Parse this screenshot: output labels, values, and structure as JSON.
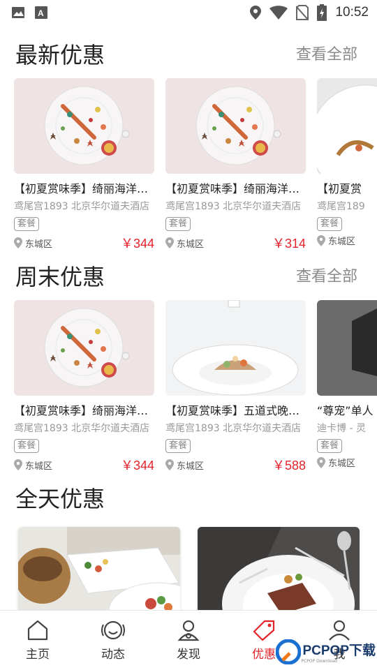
{
  "status_bar": {
    "time": "10:52"
  },
  "sections": [
    {
      "title": "最新优惠",
      "view_all": "查看全部",
      "cards": [
        {
          "title": "【初夏赏味季】绮丽海洋…",
          "venue": "鸢尾宫1893 北京华尔道夫酒店",
          "tag": "套餐",
          "district": "东城区",
          "price": "￥344"
        },
        {
          "title": "【初夏赏味季】绮丽海洋…",
          "venue": "鸢尾宫1893 北京华尔道夫酒店",
          "tag": "套餐",
          "district": "东城区",
          "price": "￥314"
        },
        {
          "title": "【初夏赏",
          "venue": "鸢尾宫189",
          "tag": "套餐",
          "district": "东城区",
          "price": ""
        }
      ]
    },
    {
      "title": "周末优惠",
      "view_all": "查看全部",
      "cards": [
        {
          "title": "【初夏赏味季】绮丽海洋…",
          "venue": "鸢尾宫1893 北京华尔道夫酒店",
          "tag": "套餐",
          "district": "东城区",
          "price": "￥344"
        },
        {
          "title": "【初夏赏味季】五道式晚…",
          "venue": "鸢尾宫1893 北京华尔道夫酒店",
          "tag": "套餐",
          "district": "东城区",
          "price": "￥588"
        },
        {
          "title": "“尊宠”单人",
          "venue": "迪卡博 - 灵",
          "tag": "套餐",
          "district": "东城区",
          "price": ""
        }
      ]
    }
  ],
  "allday": {
    "title": "全天优惠"
  },
  "nav": [
    {
      "label": "主页",
      "icon": "home-icon"
    },
    {
      "label": "动态",
      "icon": "moments-icon"
    },
    {
      "label": "发现",
      "icon": "discover-icon"
    },
    {
      "label": "优惠",
      "icon": "coupon-tag-icon",
      "active": true
    },
    {
      "label": "我",
      "icon": "profile-icon"
    }
  ],
  "watermark": {
    "brand": "PCPOP下载",
    "sub": "PCPOP Download"
  },
  "colors": {
    "accent": "#e4222a",
    "muted": "#8a8a8a"
  }
}
